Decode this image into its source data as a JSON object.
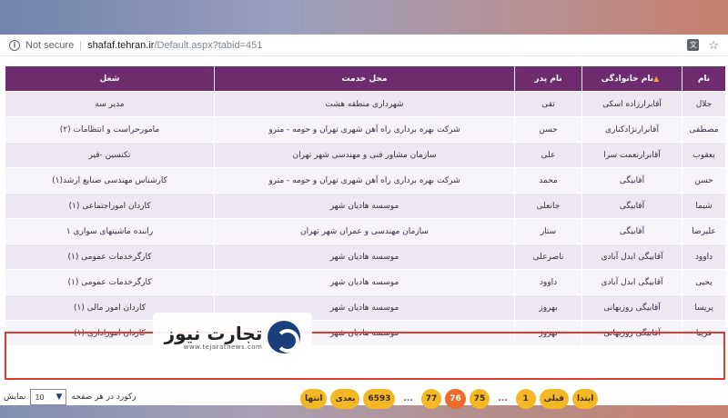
{
  "browser": {
    "security_label": "Not secure",
    "url_host": "shafaf.tehran.ir",
    "url_path": "/Default.aspx?tabid=451",
    "translate_icon": "translate-icon",
    "star_icon": "star-icon"
  },
  "table": {
    "headers": {
      "name": "نام",
      "family": "نام خانوادگی",
      "father": "نام پدر",
      "workplace": "محل خدمت",
      "job": "شغل"
    },
    "sorted_column": "family",
    "rows": [
      {
        "name": "جلال",
        "family": "آقابرارزاده اسکی",
        "father": "تقی",
        "workplace": "شهرداری منطقه هشت",
        "job": "مدیر سه"
      },
      {
        "name": "مصطفی",
        "family": "آقابرارنژادکناری",
        "father": "حسن",
        "workplace": "شرکت بهره برداری راه آهن شهری تهران و حومه - مترو",
        "job": "مامورحراست و انتظامات (۲)"
      },
      {
        "name": "یعقوب",
        "family": "آقابرارنعمت سرا",
        "father": "علی",
        "workplace": "سازمان مشاور فنی و مهندسی شهر تهران",
        "job": "تکنسین -قیر"
      },
      {
        "name": "حسن",
        "family": "آقابیگی",
        "father": "محمد",
        "workplace": "شرکت بهره برداری راه آهن شهری تهران و حومه - مترو",
        "job": "کارشناس مهندسی صنایع ارشد(۱)"
      },
      {
        "name": "شیما",
        "family": "آقابیگی",
        "father": "جانعلی",
        "workplace": "موسسه هادیان شهر",
        "job": "کاردان اموراجتماعی (۱)"
      },
      {
        "name": "علیرضا",
        "family": "آقابیگی",
        "father": "ستار",
        "workplace": "سازمان مهندسی و عمران شهر تهران",
        "job": "راننده ماشینهای سواری ۱"
      },
      {
        "name": "داوود",
        "family": "آقابیگی ابدل آبادی",
        "father": "ناصرعلی",
        "workplace": "موسسه هادیان شهر",
        "job": "کارگرخدمات عمومی (۱)"
      },
      {
        "name": "یحیی",
        "family": "آقابیگی ابدل آبادی",
        "father": "داوود",
        "workplace": "موسسه هادیان شهر",
        "job": "کارگرخدمات عمومی (۱)"
      },
      {
        "name": "پریسا",
        "family": "آقابیگی روزبهانی",
        "father": "بهروز",
        "workplace": "موسسه هادیان شهر",
        "job": "کاردان امور مالی (۱)"
      },
      {
        "name": "فریبا",
        "family": "آقابیگی روزبهانی",
        "father": "بهروز",
        "workplace": "موسسه هادیان شهر",
        "job": "کاردان اموراداری (۱)"
      }
    ]
  },
  "pager": {
    "first": "ابتدا",
    "prev": "قبلی",
    "pages": [
      "1",
      "...",
      "75",
      "76",
      "77",
      "...",
      "6593"
    ],
    "active_page": "76",
    "next": "بعدی",
    "last": "انتها",
    "accent": "#f5b825",
    "active_color": "#ee6a2b"
  },
  "page_size": {
    "show_label": "نمایش",
    "value": "10",
    "per_page_label": "رکورد در هر صفحه"
  },
  "watermark": {
    "text_fa": "تجارت نیوز",
    "text_en": "www.tejaratnews.com"
  },
  "colors": {
    "header": "#6e2c6e",
    "highlight": "#e3392b"
  }
}
